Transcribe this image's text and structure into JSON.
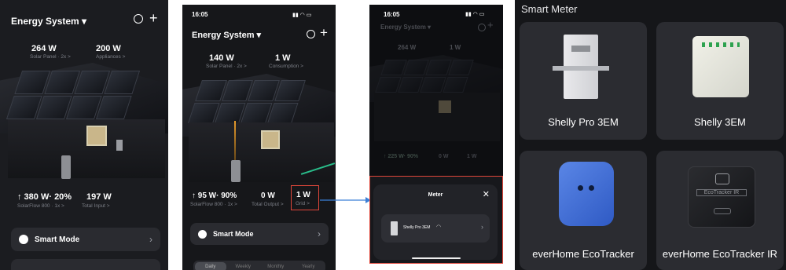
{
  "panel1": {
    "title": "Energy System ▾",
    "solar_value": "264 W",
    "solar_label": "Solar Panel · 2x >",
    "appliances_value": "200 W",
    "appliances_label": "Appliances >",
    "flow_value": "↑ 380 W· 20%",
    "flow_label": "SolarFlow 800 · 1x >",
    "input_value": "197 W",
    "input_label": "Total Input >",
    "smart_mode": "Smart Mode"
  },
  "panel2": {
    "time": "16:05",
    "title": "Energy System ▾",
    "solar_value": "140 W",
    "solar_label": "Solar Panel · 2x >",
    "consumption_value": "1 W",
    "consumption_label": "Consumption >",
    "flow_value": "↑ 95 W· 90%",
    "flow_label": "SolarFlow 800 · 1x >",
    "output_value": "0 W",
    "output_label": "Total Output >",
    "grid_value": "1 W",
    "grid_label": "Grid >",
    "smart_mode": "Smart Mode",
    "tabs": [
      "Daily",
      "Weekly",
      "Monthly",
      "Yearly"
    ]
  },
  "panel3": {
    "time": "16:05",
    "title": "Energy System ▾",
    "solar_value": "264 W",
    "consumption_value": "1 W",
    "flow_value": "↑ 225 W· 90%",
    "output_value": "0 W",
    "grid_value": "1 W",
    "modal_title": "Meter",
    "meter_item": "Shelly Pro 3EM"
  },
  "panel4": {
    "title": "Smart Meter",
    "cards": [
      "Shelly Pro 3EM",
      "Shelly 3EM",
      "everHome EcoTracker",
      "everHome EcoTracker IR"
    ],
    "device_text": "EcoTracker IR"
  },
  "colors": {
    "accent_green": "#2ee6a6",
    "highlight_red": "#e0463a",
    "arrow_blue": "#3b7fd6"
  }
}
